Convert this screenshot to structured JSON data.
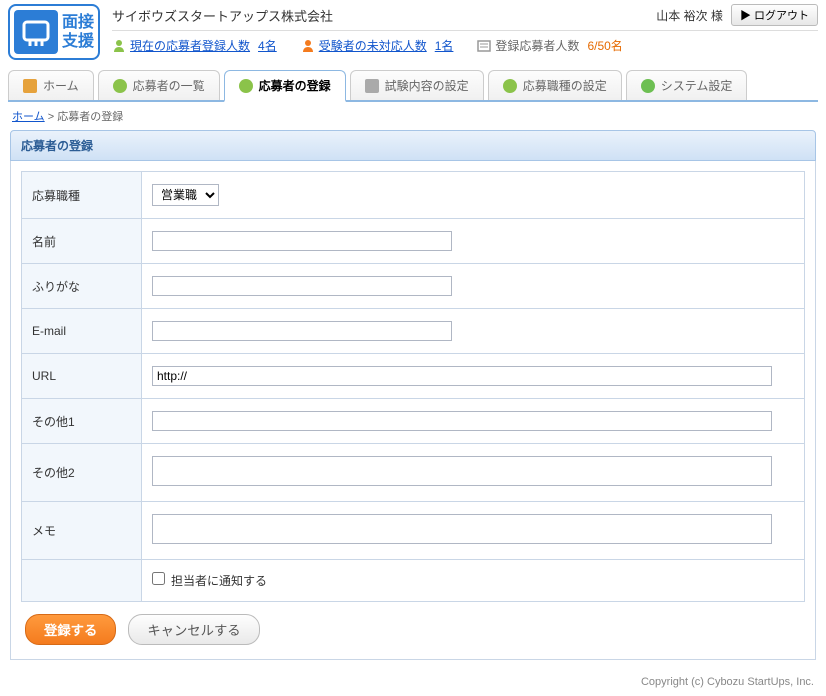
{
  "header": {
    "logo_line1": "面接",
    "logo_line2": "支援",
    "company": "サイボウズスタートアップス株式会社",
    "username": "山本 裕次 様",
    "logout_label": "ログアウト"
  },
  "stats": {
    "current_label": "現在の応募者登録人数",
    "current_count": "4名",
    "pending_label": "受験者の未対応人数",
    "pending_count": "1名",
    "capacity_label": "登録応募者人数",
    "capacity_value": "6/50名"
  },
  "tabs": [
    {
      "label": "ホーム"
    },
    {
      "label": "応募者の一覧"
    },
    {
      "label": "応募者の登録"
    },
    {
      "label": "試験内容の設定"
    },
    {
      "label": "応募職種の設定"
    },
    {
      "label": "システム設定"
    }
  ],
  "breadcrumb": {
    "home": "ホーム",
    "sep": " > ",
    "current": "応募者の登録"
  },
  "panel": {
    "title": "応募者の登録"
  },
  "form": {
    "job_label": "応募職種",
    "job_option": "営業職",
    "name_label": "名前",
    "kana_label": "ふりがな",
    "email_label": "E-mail",
    "url_label": "URL",
    "url_value": "http://",
    "other1_label": "その他1",
    "other2_label": "その他2",
    "memo_label": "メモ",
    "notify_label": "担当者に通知する"
  },
  "buttons": {
    "submit": "登録する",
    "cancel": "キャンセルする"
  },
  "footer": "Copyright (c) Cybozu StartUps, Inc."
}
